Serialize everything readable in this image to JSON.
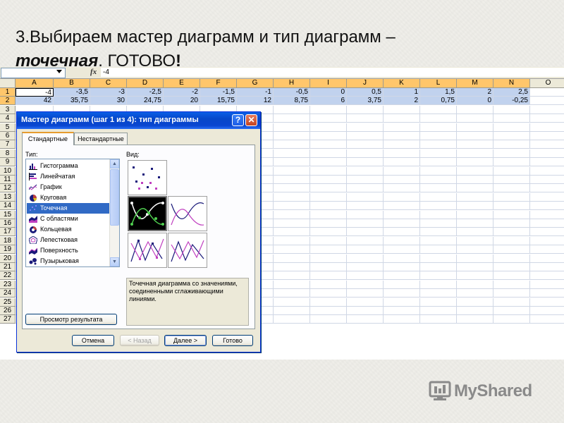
{
  "slide": {
    "title_part1": "3.Выбираем мастер диаграмм и тип диаграмм –",
    "title_part2": "точечная",
    "title_part3": ". ГОТОВО",
    "title_part4": "!"
  },
  "formula_bar": {
    "name_box": "",
    "fx_label": "fx",
    "value": "-4"
  },
  "columns": [
    "A",
    "B",
    "C",
    "D",
    "E",
    "F",
    "G",
    "H",
    "I",
    "J",
    "K",
    "L",
    "M",
    "N",
    "O"
  ],
  "rows": [
    "1",
    "2",
    "3",
    "4",
    "5",
    "6",
    "7",
    "8",
    "9",
    "10",
    "11",
    "12",
    "13",
    "14",
    "15",
    "16",
    "17",
    "18",
    "19",
    "20",
    "21",
    "22",
    "23",
    "24",
    "25",
    "26",
    "27"
  ],
  "cells": {
    "row1": [
      "-4",
      "-3,5",
      "-3",
      "-2,5",
      "-2",
      "-1,5",
      "-1",
      "-0,5",
      "0",
      "0,5",
      "1",
      "1,5",
      "2",
      "2,5"
    ],
    "row2": [
      "42",
      "35,75",
      "30",
      "24,75",
      "20",
      "15,75",
      "12",
      "8,75",
      "6",
      "3,75",
      "2",
      "0,75",
      "0",
      "-0,25"
    ]
  },
  "dialog": {
    "title": "Мастер диаграмм (шаг 1 из 4): тип диаграммы",
    "help": "?",
    "close": "✕",
    "tabs": [
      "Стандартные",
      "Нестандартные"
    ],
    "type_label": "Тип:",
    "view_label": "Вид:",
    "chart_types": [
      {
        "label": "Гистограмма",
        "icon": "column-chart-icon"
      },
      {
        "label": "Линейчатая",
        "icon": "bar-chart-icon"
      },
      {
        "label": "График",
        "icon": "line-chart-icon"
      },
      {
        "label": "Круговая",
        "icon": "pie-chart-icon"
      },
      {
        "label": "Точечная",
        "icon": "scatter-chart-icon"
      },
      {
        "label": "С областями",
        "icon": "area-chart-icon"
      },
      {
        "label": "Кольцевая",
        "icon": "doughnut-chart-icon"
      },
      {
        "label": "Лепестковая",
        "icon": "radar-chart-icon"
      },
      {
        "label": "Поверхность",
        "icon": "surface-chart-icon"
      },
      {
        "label": "Пузырьковая",
        "icon": "bubble-chart-icon"
      }
    ],
    "selected_type": "Точечная",
    "description": "Точечная диаграмма со значениями, соединенными сглаживающими линиями.",
    "preview_button": "Просмотр результата",
    "buttons": {
      "cancel": "Отмена",
      "back": "< Назад",
      "next": "Далее >",
      "finish": "Готово"
    }
  },
  "logo": {
    "text": "MyShared",
    "icon": "myshared-logo-icon"
  },
  "colors": {
    "selection": "#c1d2ee",
    "header_selected": "#ffc66b",
    "titlebar": "#0747c9",
    "list_selected": "#316ac5"
  }
}
